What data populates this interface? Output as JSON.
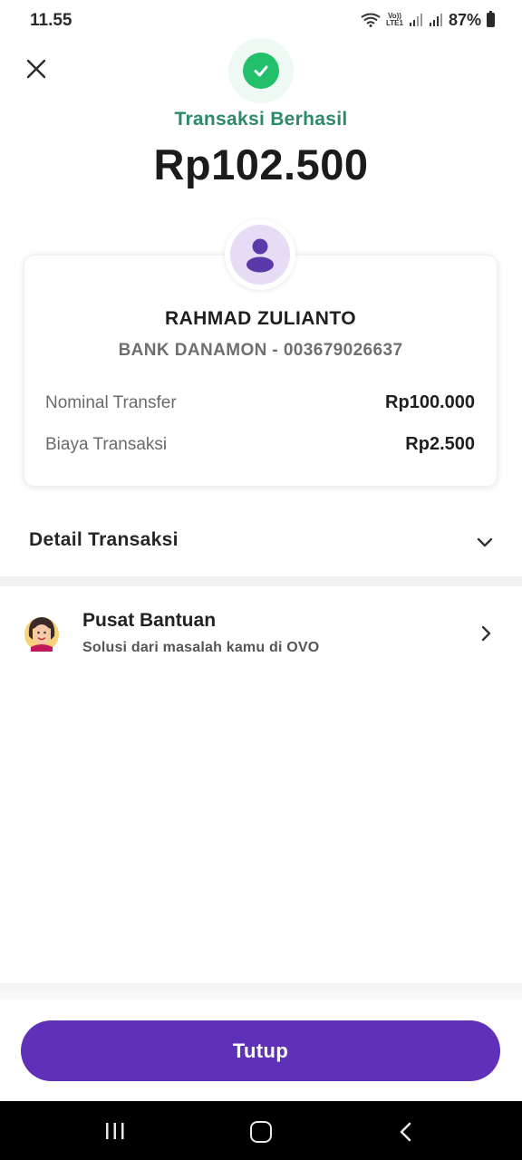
{
  "status_bar": {
    "time": "11.55",
    "volte_line1": "Vo))",
    "volte_line2": "LTE1",
    "battery": "87%",
    "icons": [
      "wifi-icon",
      "signal-icon",
      "battery-icon"
    ]
  },
  "header": {
    "status_text": "Transaksi Berhasil",
    "amount": "Rp102.500",
    "success_color": "#22c06b"
  },
  "recipient": {
    "name": "RAHMAD ZULIANTO",
    "bank_account": "BANK DANAMON - 003679026637"
  },
  "breakdown": [
    {
      "label": "Nominal Transfer",
      "value": "Rp100.000"
    },
    {
      "label": "Biaya Transaksi",
      "value": "Rp2.500"
    }
  ],
  "detail": {
    "label": "Detail Transaksi"
  },
  "help": {
    "title": "Pusat Bantuan",
    "subtitle": "Solusi dari masalah kamu di OVO"
  },
  "footer": {
    "button_label": "Tutup",
    "accent": "#5e31b8"
  }
}
